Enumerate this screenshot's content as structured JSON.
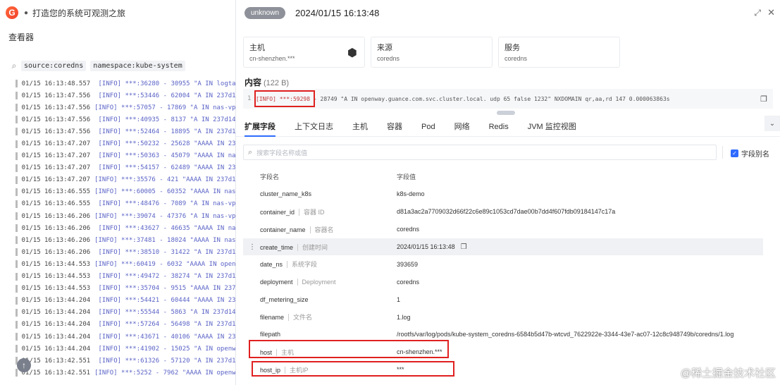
{
  "left_panel": {
    "app_title": "打造您的系统可观测之旅",
    "viewer_label": "查看器",
    "search_tokens": [
      "source:coredns",
      "namespace:kube-system"
    ],
    "log_rows": [
      {
        "ts": "01/15 16:13:48.557",
        "msg": "[INFO] ***:36280 - 30955 \"A IN logtas"
      },
      {
        "ts": "01/15 16:13:47.556",
        "msg": "[INFO] ***:53446 - 62004 \"A IN 237d14"
      },
      {
        "ts": "01/15 16:13:47.556",
        "msg": "[INFO] ***:57057 - 17869 \"A IN nas-vpc"
      },
      {
        "ts": "01/15 16:13:47.556",
        "msg": "[INFO] ***:40935 - 8137 \"A IN 237d14a"
      },
      {
        "ts": "01/15 16:13:47.556",
        "msg": "[INFO] ***:52464 - 18895 \"A IN 237d14"
      },
      {
        "ts": "01/15 16:13:47.207",
        "msg": "[INFO] ***:50232 - 25628 \"AAAA IN 237"
      },
      {
        "ts": "01/15 16:13:47.207",
        "msg": "[INFO] ***:50363 - 45079 \"AAAA IN nas"
      },
      {
        "ts": "01/15 16:13:47.207",
        "msg": "[INFO] ***:54157 - 62489 \"AAAA IN 237"
      },
      {
        "ts": "01/15 16:13:47.207",
        "msg": "[INFO] ***:35576 - 421 \"AAAA IN 237d14"
      },
      {
        "ts": "01/15 16:13:46.555",
        "msg": "[INFO] ***:60005 - 60352 \"AAAA IN nas-"
      },
      {
        "ts": "01/15 16:13:46.555",
        "msg": "[INFO] ***:48476 - 7089 \"A IN nas-vpc"
      },
      {
        "ts": "01/15 16:13:46.206",
        "msg": "[INFO] ***:39074 - 47376 \"A IN nas-vpc"
      },
      {
        "ts": "01/15 16:13:46.206",
        "msg": "[INFO] ***:43627 - 46635 \"AAAA IN nas"
      },
      {
        "ts": "01/15 16:13:46.206",
        "msg": "[INFO] ***:37481 - 18024 \"AAAA IN nas-"
      },
      {
        "ts": "01/15 16:13:46.206",
        "msg": "[INFO] ***:38510 - 31422 \"A IN 237d14"
      },
      {
        "ts": "01/15 16:13:44.553",
        "msg": "[INFO] ***:60419 - 6032 \"AAAA IN openw"
      },
      {
        "ts": "01/15 16:13:44.553",
        "msg": "[INFO] ***:49472 - 38274 \"A IN 237d14"
      },
      {
        "ts": "01/15 16:13:44.553",
        "msg": "[INFO] ***:35704 - 9515 \"AAAA IN 237d"
      },
      {
        "ts": "01/15 16:13:44.204",
        "msg": "[INFO] ***:54421 - 60444 \"AAAA IN 237"
      },
      {
        "ts": "01/15 16:13:44.204",
        "msg": "[INFO] ***:55544 - 5863 \"A IN 237d14a"
      },
      {
        "ts": "01/15 16:13:44.204",
        "msg": "[INFO] ***:57264 - 56498 \"A IN 237d14"
      },
      {
        "ts": "01/15 16:13:44.204",
        "msg": "[INFO] ***:43671 - 40106 \"AAAA IN 237"
      },
      {
        "ts": "01/15 16:13:44.204",
        "msg": "[INFO] ***:41902 - 15025 \"A IN openwa"
      },
      {
        "ts": "01/15 16:13:42.551",
        "msg": "[INFO] ***:61326 - 57120 \"A IN 237d14"
      },
      {
        "ts": "01/15 16:13:42.551",
        "msg": "[INFO] ***:5252 - 7962 \"AAAA IN openwa"
      }
    ]
  },
  "drawer": {
    "status_badge": "unknown",
    "timestamp": "2024/01/15 16:13:48",
    "cards": [
      {
        "title": "主机",
        "value": "cn-shenzhen.***"
      },
      {
        "title": "来源",
        "value": "coredns"
      },
      {
        "title": "服务",
        "value": "coredns"
      }
    ],
    "content_title": "内容",
    "content_size": "(122 B)",
    "content_line_no": "1",
    "content_highlight": "[INFO] ***:59298",
    "content_rest": " - 28749 \"A IN openway.guance.com.svc.cluster.local. udp 65 false 1232\" NXDOMAIN qr,aa,rd 147 0.000063863s",
    "tabs": [
      "扩展字段",
      "上下文日志",
      "主机",
      "容器",
      "Pod",
      "网络",
      "Redis",
      "JVM 监控视图"
    ],
    "field_search_placeholder": "搜索字段名称或值",
    "field_alias_label": "字段别名",
    "table_header": {
      "name": "字段名",
      "value": "字段值"
    },
    "fields": [
      {
        "name": "cluster_name_k8s",
        "alias": "",
        "value": "k8s-demo"
      },
      {
        "name": "container_id",
        "alias": "容器 ID",
        "value": "d81a3ac2a7709032d66f22c6e89c1053cd7dae00b7dd4f607fdb09184147c17a"
      },
      {
        "name": "container_name",
        "alias": "容器名",
        "value": "coredns"
      },
      {
        "name": "create_time",
        "alias": "创建时间",
        "value": "2024/01/15 16:13:48"
      },
      {
        "name": "date_ns",
        "alias": "系统字段",
        "value": "393659"
      },
      {
        "name": "deployment",
        "alias": "Deployment",
        "value": "coredns"
      },
      {
        "name": "df_metering_size",
        "alias": "",
        "value": "1"
      },
      {
        "name": "filename",
        "alias": "文件名",
        "value": "1.log"
      },
      {
        "name": "filepath",
        "alias": "",
        "value": "/rootfs/var/log/pods/kube-system_coredns-6584b5d47b-wtcvd_7622922e-3344-43e7-ac07-12c8c948749b/coredns/1.log"
      },
      {
        "name": "host",
        "alias": "主机",
        "value": "cn-shenzhen.***"
      },
      {
        "name": "host_ip",
        "alias": "主机IP",
        "value": "***"
      }
    ]
  },
  "watermarks": {
    "corner": "@稀土掘金技术社区"
  },
  "colors": {
    "accent": "#2f6bff",
    "highlight_box": "#e02020",
    "log_message": "#5a63c6"
  }
}
